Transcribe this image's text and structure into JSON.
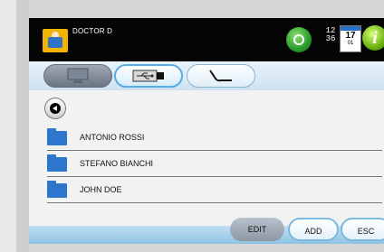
{
  "header": {
    "user_name": "DOCTOR D",
    "clock_hour": "12",
    "clock_minute": "36",
    "calendar_day": "17",
    "calendar_month": "01",
    "info_label": "i"
  },
  "tabs": [
    {
      "name": "computer",
      "icon": "computer-icon",
      "state": "disabled"
    },
    {
      "name": "usb",
      "icon": "usb-icon",
      "state": "selected"
    },
    {
      "name": "cable",
      "icon": "cable-icon",
      "state": "normal"
    }
  ],
  "list": {
    "items": [
      {
        "name": "ANTONIO ROSSI",
        "icon": "folder-icon"
      },
      {
        "name": "STEFANO BIANCHI",
        "icon": "folder-icon"
      },
      {
        "name": "JOHN DOE",
        "icon": "folder-icon"
      }
    ]
  },
  "actions": {
    "edit_label": "EDIT",
    "add_label": "ADD",
    "esc_label": "ESC"
  },
  "colors": {
    "topbar": "#050505",
    "accent_blue": "#56aee8",
    "folder_blue": "#2e76cc",
    "sync_green": "#2b9a2b",
    "info_green": "#6bb20f",
    "user_icon_yellow": "#f2b400"
  }
}
